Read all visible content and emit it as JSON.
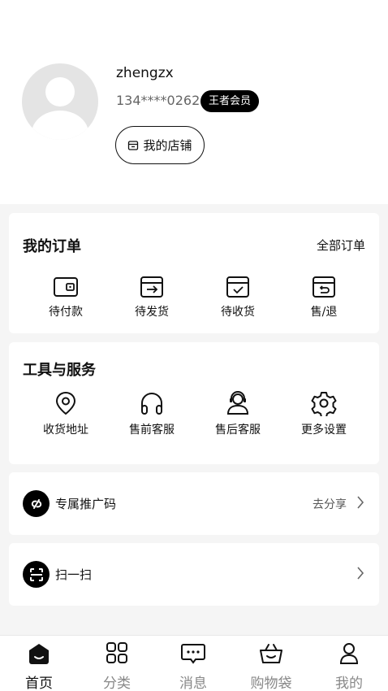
{
  "profile": {
    "username": "zhengzx",
    "phone": "134****0262",
    "badge": "王者会员",
    "shop_button": "我的店铺"
  },
  "orders": {
    "title": "我的订单",
    "all_link": "全部订单",
    "items": [
      {
        "label": "待付款",
        "icon": "wallet-icon"
      },
      {
        "label": "待发货",
        "icon": "box-arrow-icon"
      },
      {
        "label": "待收货",
        "icon": "box-check-icon"
      },
      {
        "label": "售/退",
        "icon": "box-return-icon"
      }
    ]
  },
  "tools": {
    "title": "工具与服务",
    "items": [
      {
        "label": "收货地址",
        "icon": "location-pin-icon"
      },
      {
        "label": "售前客服",
        "icon": "headphones-icon"
      },
      {
        "label": "售后客服",
        "icon": "agent-icon"
      },
      {
        "label": "更多设置",
        "icon": "gear-icon"
      }
    ]
  },
  "promo": {
    "label": "专属推广码",
    "action": "去分享",
    "icon": "link-icon"
  },
  "scan": {
    "label": "扫一扫",
    "icon": "scan-icon"
  },
  "tabbar": {
    "items": [
      {
        "label": "首页",
        "icon": "home-icon",
        "active": true
      },
      {
        "label": "分类",
        "icon": "category-icon",
        "active": false
      },
      {
        "label": "消息",
        "icon": "message-icon",
        "active": false
      },
      {
        "label": "购物袋",
        "icon": "basket-icon",
        "active": false
      },
      {
        "label": "我的",
        "icon": "user-icon",
        "active": false
      }
    ]
  }
}
